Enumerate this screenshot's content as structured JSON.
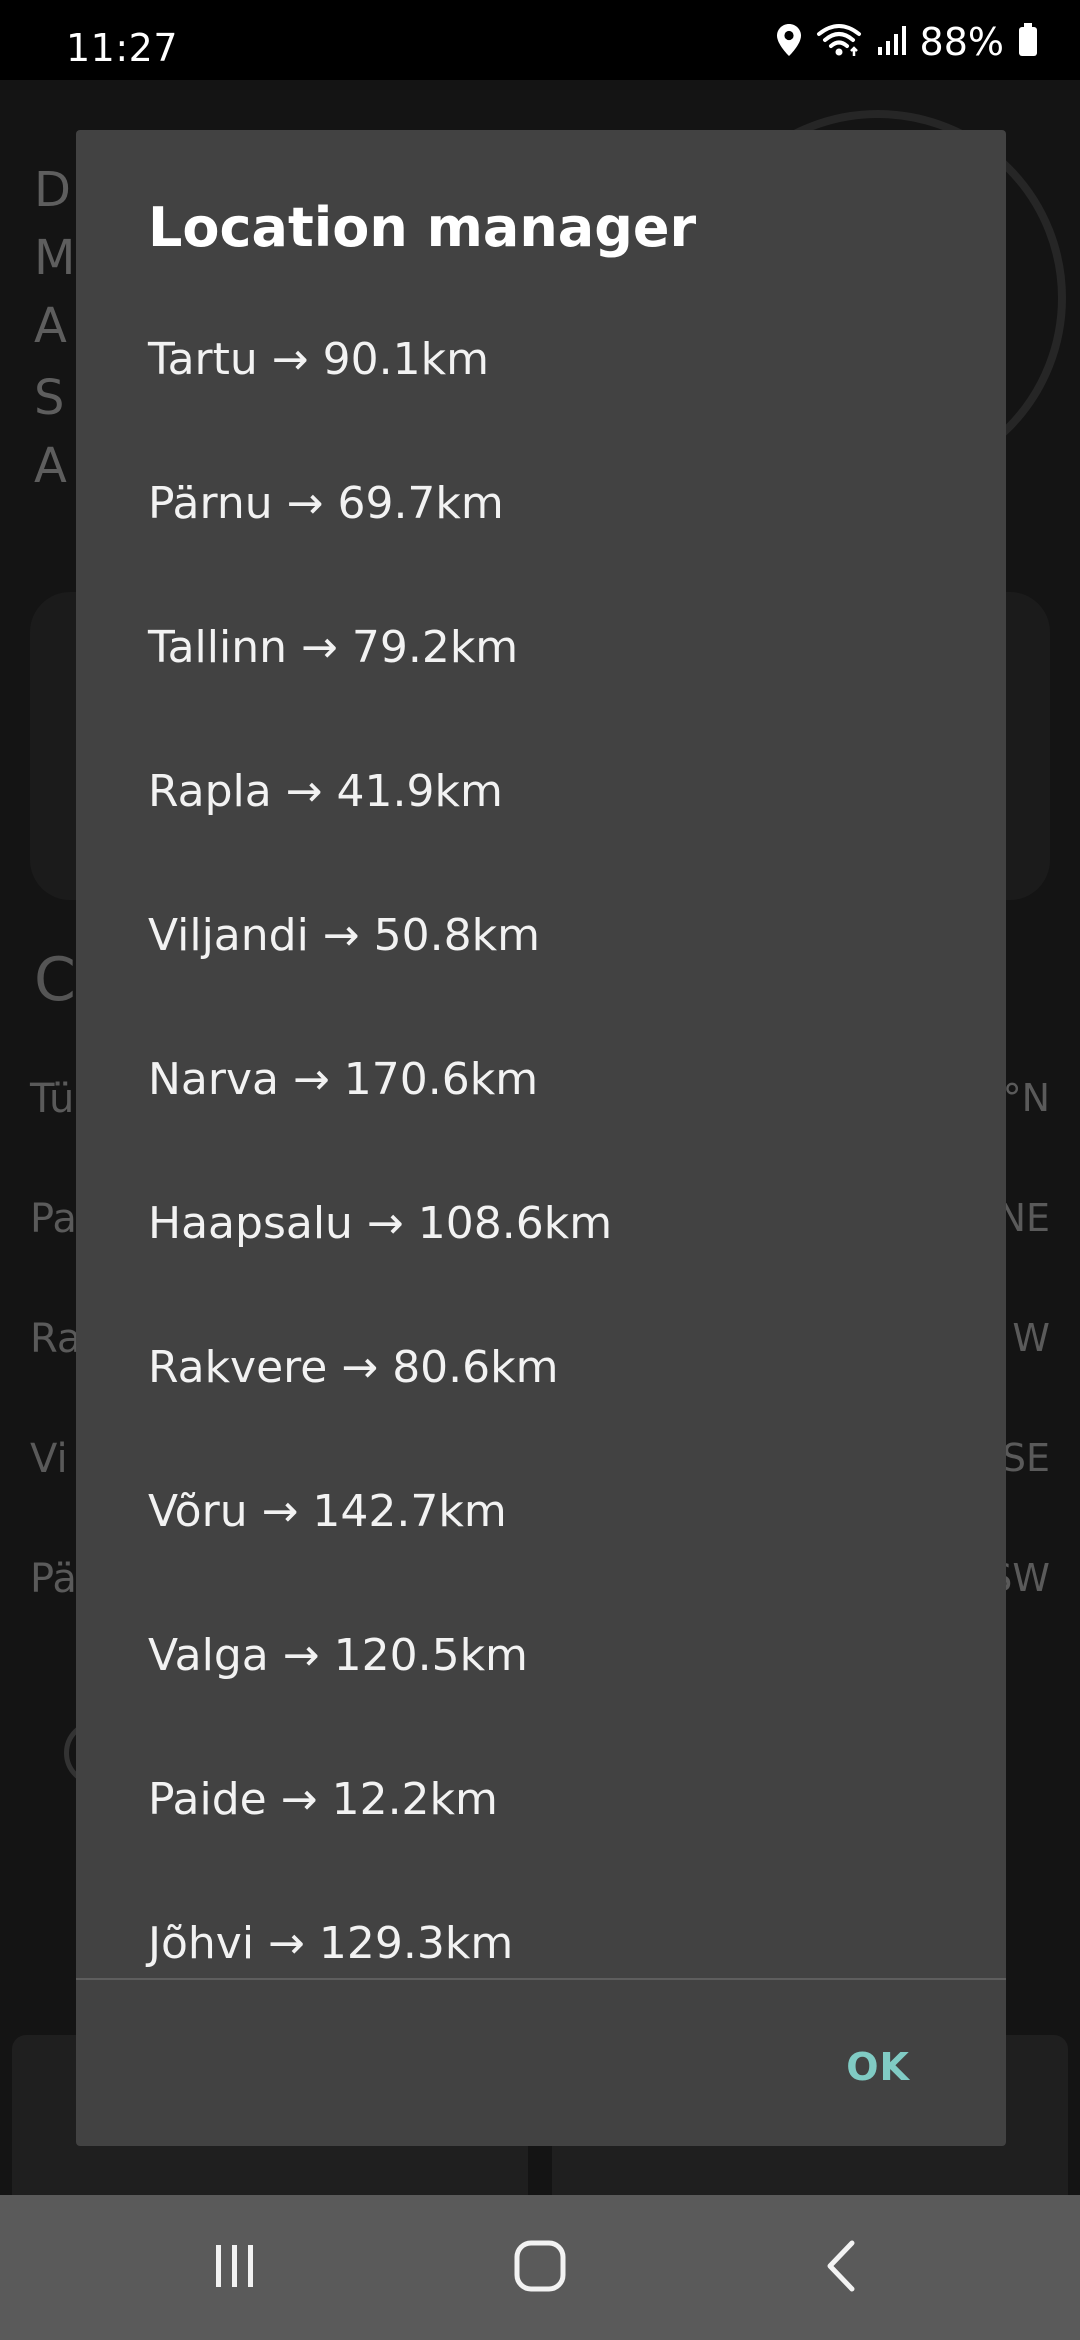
{
  "status_bar": {
    "time": "11:27",
    "battery": "88%",
    "icons": [
      "location-pin-icon",
      "wifi-icon",
      "signal-icon",
      "battery-icon"
    ]
  },
  "dialog": {
    "title": "Location manager",
    "items": [
      "Tartu → 90.1km",
      "Pärnu → 69.7km",
      "Tallinn → 79.2km",
      "Rapla → 41.9km",
      "Viljandi → 50.8km",
      "Narva → 170.6km",
      "Haapsalu → 108.6km",
      "Rakvere → 80.6km",
      "Võru → 142.7km",
      "Valga → 120.5km",
      "Paide → 12.2km",
      "Jõhvi → 129.3km"
    ],
    "ok_label": "OK"
  },
  "background": {
    "left_letters": [
      "D",
      "M",
      "A",
      "S",
      "A"
    ],
    "section_letter": "C",
    "rows": [
      {
        "label": "Tü",
        "dir": "°N"
      },
      {
        "label": "Pa",
        "dir": "NE"
      },
      {
        "label": "Ra",
        "dir": "W"
      },
      {
        "label": "Vi",
        "dir": "SE"
      },
      {
        "label": "Pä",
        "dir": "SW"
      }
    ]
  },
  "nav_bar": {
    "icons": [
      "recent-apps-icon",
      "home-icon",
      "back-icon"
    ]
  },
  "colors": {
    "dialog_bg": "#424242",
    "accent": "#80cbc4",
    "nav_bg": "#5a5a5a"
  }
}
